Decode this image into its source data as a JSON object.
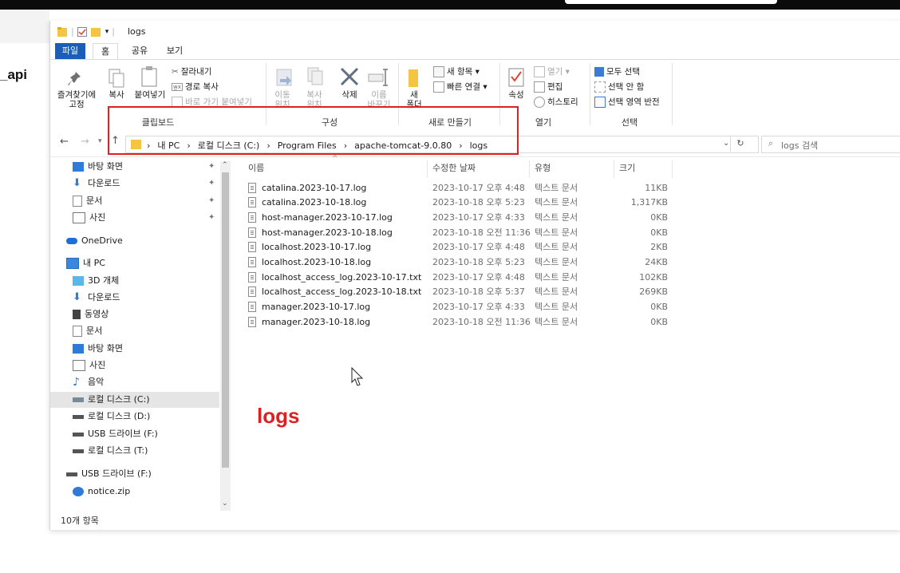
{
  "background": {
    "left_text": "_api"
  },
  "window": {
    "title": "logs",
    "menu_tabs": [
      {
        "label": "파일"
      },
      {
        "label": "홈"
      },
      {
        "label": "공유"
      },
      {
        "label": "보기"
      }
    ]
  },
  "ribbon": {
    "clipboard": {
      "group_label": "클립보드",
      "pin_label": "즐겨찾기에\n고정",
      "copy_label": "복사",
      "paste_label": "붙여넣기",
      "cut_label": "잘라내기",
      "copy_path_label": "경로 복사",
      "paste_shortcut_label": "바로 가기 붙여넣기"
    },
    "organize": {
      "group_label": "구성",
      "move_label": "이동\n위치",
      "copyto_label": "복사\n위치",
      "delete_label": "삭제",
      "rename_label": "이름\n바꾸기"
    },
    "new": {
      "group_label": "새로 만들기",
      "new_folder_label": "새\n폴더",
      "new_item_label": "새 항목 ▾",
      "easy_access_label": "빠른 연결 ▾"
    },
    "open": {
      "group_label": "열기",
      "properties_label": "속성",
      "open_label": "열기 ▾",
      "edit_label": "편집",
      "history_label": "히스토리"
    },
    "select": {
      "group_label": "선택",
      "select_all_label": "모두 선택",
      "select_none_label": "선택 안 함",
      "invert_label": "선택 영역 반전"
    }
  },
  "address": {
    "path": [
      "내 PC",
      "로컬 디스크 (C:)",
      "Program Files",
      "apache-tomcat-9.0.80",
      "logs"
    ],
    "search_placeholder": "logs 검색"
  },
  "nav": {
    "items": [
      {
        "label": "바탕 화면",
        "icon": "desktop-icon",
        "pinned": true
      },
      {
        "label": "다운로드",
        "icon": "download-icon",
        "pinned": true
      },
      {
        "label": "문서",
        "icon": "document-icon",
        "pinned": true
      },
      {
        "label": "사진",
        "icon": "pictures-icon",
        "pinned": true
      },
      {
        "label": "OneDrive",
        "icon": "cloud-icon"
      },
      {
        "label": "내 PC",
        "icon": "pc-icon"
      },
      {
        "label": "3D 개체",
        "icon": "cube-icon"
      },
      {
        "label": "다운로드",
        "icon": "download-icon"
      },
      {
        "label": "동영상",
        "icon": "video-icon"
      },
      {
        "label": "문서",
        "icon": "document-icon"
      },
      {
        "label": "바탕 화면",
        "icon": "desktop-icon"
      },
      {
        "label": "사진",
        "icon": "pictures-icon"
      },
      {
        "label": "음악",
        "icon": "music-icon"
      },
      {
        "label": "로컬 디스크 (C:)",
        "icon": "drive-icon",
        "selected": true
      },
      {
        "label": "로컬 디스크 (D:)",
        "icon": "drive-icon"
      },
      {
        "label": "USB 드라이브 (F:)",
        "icon": "drive-icon"
      },
      {
        "label": "로컬 디스크 (T:)",
        "icon": "drive-icon"
      },
      {
        "label": "USB 드라이브 (F:)",
        "icon": "drive-icon"
      },
      {
        "label": "notice.zip",
        "icon": "zip-icon"
      }
    ]
  },
  "list": {
    "columns": [
      "이름",
      "수정한 날짜",
      "유형",
      "크기"
    ],
    "rows": [
      {
        "name": "catalina.2023-10-17.log",
        "date": "2023-10-17 오후 4:48",
        "type": "텍스트 문서",
        "size": "11KB"
      },
      {
        "name": "catalina.2023-10-18.log",
        "date": "2023-10-18 오후 5:23",
        "type": "텍스트 문서",
        "size": "1,317KB"
      },
      {
        "name": "host-manager.2023-10-17.log",
        "date": "2023-10-17 오후 4:33",
        "type": "텍스트 문서",
        "size": "0KB"
      },
      {
        "name": "host-manager.2023-10-18.log",
        "date": "2023-10-18 오전 11:36",
        "type": "텍스트 문서",
        "size": "0KB"
      },
      {
        "name": "localhost.2023-10-17.log",
        "date": "2023-10-17 오후 4:48",
        "type": "텍스트 문서",
        "size": "2KB"
      },
      {
        "name": "localhost.2023-10-18.log",
        "date": "2023-10-18 오후 5:23",
        "type": "텍스트 문서",
        "size": "24KB"
      },
      {
        "name": "localhost_access_log.2023-10-17.txt",
        "date": "2023-10-17 오후 4:48",
        "type": "텍스트 문서",
        "size": "102KB"
      },
      {
        "name": "localhost_access_log.2023-10-18.txt",
        "date": "2023-10-18 오후 5:37",
        "type": "텍스트 문서",
        "size": "269KB"
      },
      {
        "name": "manager.2023-10-17.log",
        "date": "2023-10-17 오후 4:33",
        "type": "텍스트 문서",
        "size": "0KB"
      },
      {
        "name": "manager.2023-10-18.log",
        "date": "2023-10-18 오전 11:36",
        "type": "텍스트 문서",
        "size": "0KB"
      }
    ]
  },
  "status": {
    "count_label": "10개 항목"
  },
  "annotation": {
    "overlay_text": "logs",
    "color": "#e02020"
  },
  "colors": {
    "accent": "#1a5eb8",
    "folder": "#f4c542",
    "selection": "#e5e5e5"
  }
}
